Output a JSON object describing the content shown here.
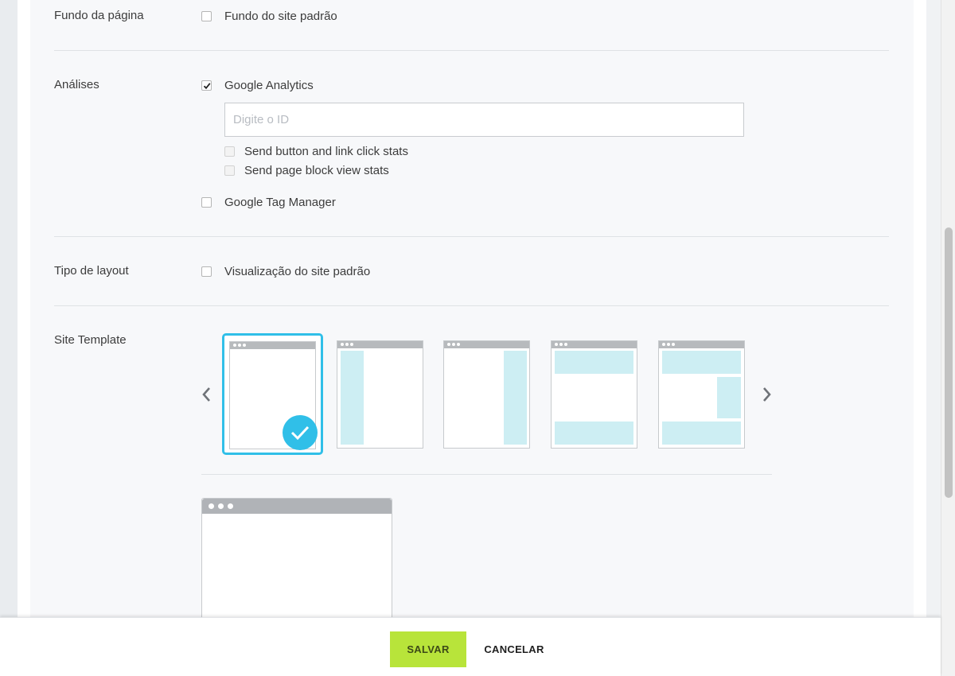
{
  "sections": {
    "page_background": {
      "label": "Fundo da página",
      "checkbox_label": "Fundo do site padrão",
      "checked": false
    },
    "analytics": {
      "label": "Análises",
      "google_analytics_label": "Google Analytics",
      "google_analytics_checked": true,
      "id_input": {
        "placeholder": "Digite o ID",
        "value": ""
      },
      "sub_options": [
        {
          "label": "Send button and link click stats",
          "checked": false
        },
        {
          "label": "Send page block view stats",
          "checked": false
        }
      ],
      "google_tag_manager_label": "Google Tag Manager",
      "google_tag_manager_checked": false
    },
    "layout_type": {
      "label": "Tipo de layout",
      "checkbox_label": "Visualização do site padrão",
      "checked": false
    },
    "site_template": {
      "label": "Site Template",
      "selected_index": 0,
      "templates": [
        "blank",
        "left-sidebar",
        "right-sidebar",
        "header-footer",
        "header-footer-right-box"
      ]
    }
  },
  "footer": {
    "save_label": "SALVAR",
    "cancel_label": "CANCELAR"
  },
  "colors": {
    "accent": "#30bfe8",
    "save_button": "#b8e43a",
    "template_block": "#cdeef3"
  }
}
